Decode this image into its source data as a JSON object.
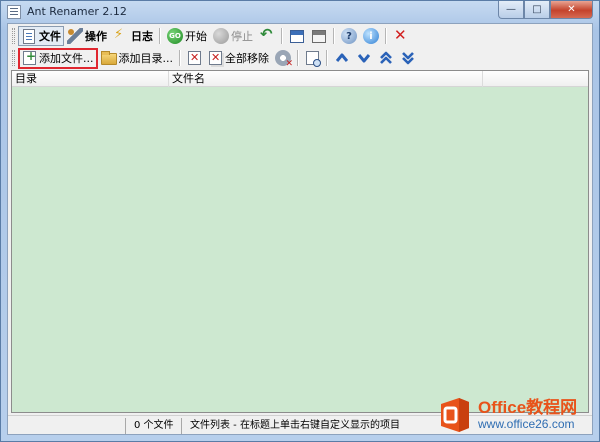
{
  "window": {
    "title": "Ant Renamer 2.12",
    "min_glyph": "—",
    "max_glyph": "□",
    "close_glyph": "✕"
  },
  "toolbar1": {
    "file": "文件",
    "actions": "操作",
    "log": "日志",
    "start": "开始",
    "stop": "停止",
    "go_icon_text": "GO",
    "help_icon_text": "?",
    "info_icon_text": "i"
  },
  "toolbar2": {
    "add_files": "添加文件...",
    "add_folder": "添加目录...",
    "remove_all": "全部移除"
  },
  "list": {
    "columns": [
      "目录",
      "文件名",
      ""
    ]
  },
  "statusbar": {
    "count": "0 个文件",
    "hint": "文件列表 - 在标题上单击右键自定义显示的项目"
  },
  "watermark": {
    "title": "Office教程网",
    "url": "www.office26.com"
  },
  "colors": {
    "list_bg": "#cde8d0",
    "highlight": "#e0262f",
    "watermark_orange": "#e8531a",
    "watermark_blue": "#2f6db2"
  }
}
